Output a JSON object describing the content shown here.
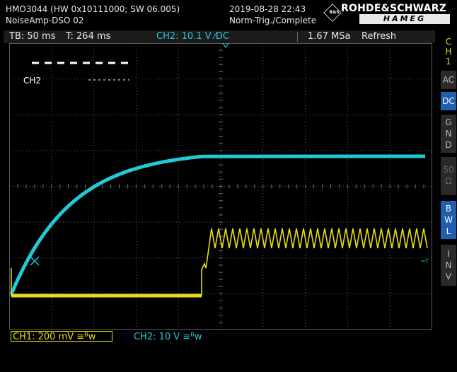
{
  "header": {
    "device": "HMO3044 (HW 0x10111000; SW 06.005)",
    "file": "NoiseAmp-DSO 02",
    "datetime": "2019-08-28 22:43",
    "trigger_status": "Norm-Trig./Complete",
    "brand_top": "ROHDE&SCHWARZ",
    "brand_bottom": "HAMEG",
    "brand_badge": "R&S"
  },
  "info_bar": {
    "timebase": "TB: 50 ms",
    "trigger_time": "T: 264 ms",
    "ch2_trigger": "CH2: 10.1 V ⁄DC",
    "sample_rate": "1.67 MSa",
    "mode": "Refresh"
  },
  "plot": {
    "legend_label": "CH2",
    "ch1_marker": "1",
    "trigger_marker": "T"
  },
  "bottom_bar": {
    "ch1": "CH1: 200 mV ≅ᴮw",
    "ch2": "CH2: 10 V ≅ᴮw"
  },
  "sidebar": {
    "channel": [
      "C",
      "H",
      "1"
    ],
    "ac": "AC",
    "dc": "DC",
    "gnd": [
      "G",
      "N",
      "D"
    ],
    "fifty": [
      "50",
      "Ω"
    ],
    "bwl": [
      "B",
      "W",
      "L"
    ],
    "inv": [
      "I",
      "N",
      "V"
    ]
  },
  "colors": {
    "ch1": "#e6dd1a",
    "ch2": "#22c9d6",
    "grid": "#5a5a5a",
    "active_button": "#1e5fae"
  }
}
